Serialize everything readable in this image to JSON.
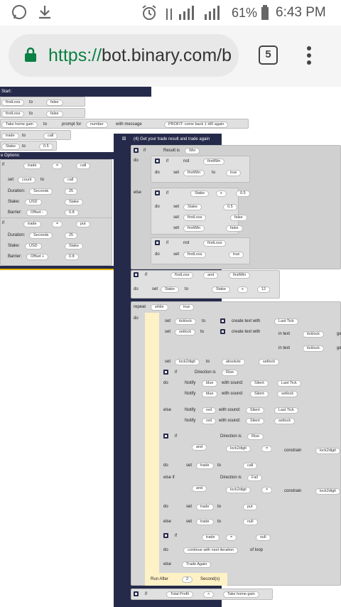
{
  "status": {
    "percent": "61%",
    "time": "6:43 PM"
  },
  "browser": {
    "url_scheme": "https://",
    "url_host": "bot.binary.com/b",
    "tab_count": "5"
  },
  "header": {
    "start": "Start:",
    "trade_result": "(4) Get your trade result and trade again",
    "options": "e Options:"
  },
  "start_rows": [
    {
      "a": "firstLoss",
      "k": "to",
      "b": "false"
    },
    {
      "a": "firstLoss",
      "k": "to",
      "b": "false"
    },
    {
      "a": "Take home gain",
      "k": "to",
      "b": "prompt for",
      "c": "number",
      "d": "with message",
      "e": "PROFIT: come back 1 HR again"
    },
    {
      "a": "trade",
      "k": "to",
      "b": "call"
    },
    {
      "a": "Stake",
      "k": "to",
      "b": "0.5"
    }
  ],
  "left": {
    "if1": "if",
    "trade": "trade",
    "eq": "=",
    "call": "call",
    "set": "set",
    "count": "count",
    "to": "to",
    "duration": "Duration:",
    "seconds": "Seconds",
    "dur_val": "25",
    "stake": "Stake:",
    "usd": "USD",
    "stake_var": "Stake",
    "barrier": "Barrier:",
    "offset_minus": "Offset -",
    "offset_plus": "Offset +",
    "bar_val": "0.8",
    "put": "put"
  },
  "main": {
    "if": "if",
    "do": "do",
    "else": "else",
    "not": "not",
    "result_is": "Result is",
    "win": "Win",
    "firstWin": "firstWin",
    "true": "true",
    "false": "false",
    "firstLoss": "firstLoss",
    "stake": "Stake",
    "mult": "x",
    "half": "0.5",
    "and": "and",
    "twelve": "12",
    "repeat": "repeat",
    "while": "while",
    "ticklock": "ticklock",
    "setlock": "setlock",
    "lock2digit": "lock2digit",
    "create_text": "create text with",
    "last_tick": "Last Tick",
    "in_text": "in text",
    "absolute": "absolute",
    "direction_is": "Direction is",
    "rise": "Rise",
    "fall": "Fall",
    "notify": "Notify",
    "blue": "blue",
    "red": "red",
    "with_sound": "with sound:",
    "silent": "Silent",
    "else_if": "else if",
    "constrain": "constrain",
    "call": "call",
    "put": "put",
    "null": "null",
    "trade": "trade",
    "eq": "=",
    "continue": "continue with next iteration",
    "of_loop": "of loop",
    "trade_again": "Trade Again",
    "run_after": "Run After",
    "run_val": "2",
    "seconds": "Second(s)",
    "total_profit": "Total Profit",
    "lt": "<",
    "take_home": "Take home gain",
    "ge": "ge",
    "set": "set",
    "to": "to"
  }
}
